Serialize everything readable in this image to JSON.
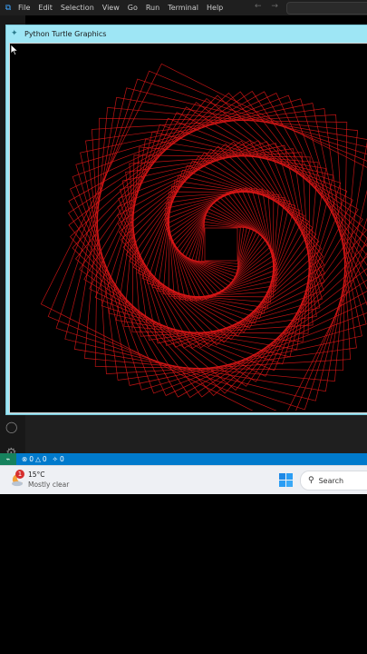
{
  "vscode": {
    "menu": [
      "File",
      "Edit",
      "Selection",
      "View",
      "Go",
      "Run",
      "Terminal",
      "Help"
    ],
    "nav_back": "←",
    "nav_forward": "→"
  },
  "turtle_window": {
    "title": "Python Turtle Graphics",
    "spiral_color": "#e01818",
    "canvas_color": "#000000"
  },
  "statusbar": {
    "remote_glyph": "⌁",
    "errors": "0",
    "warnings": "0",
    "ports": "0"
  },
  "taskbar": {
    "weather_badge": "1",
    "temperature": "15°C",
    "condition": "Mostly clear",
    "search_label": "Search"
  }
}
